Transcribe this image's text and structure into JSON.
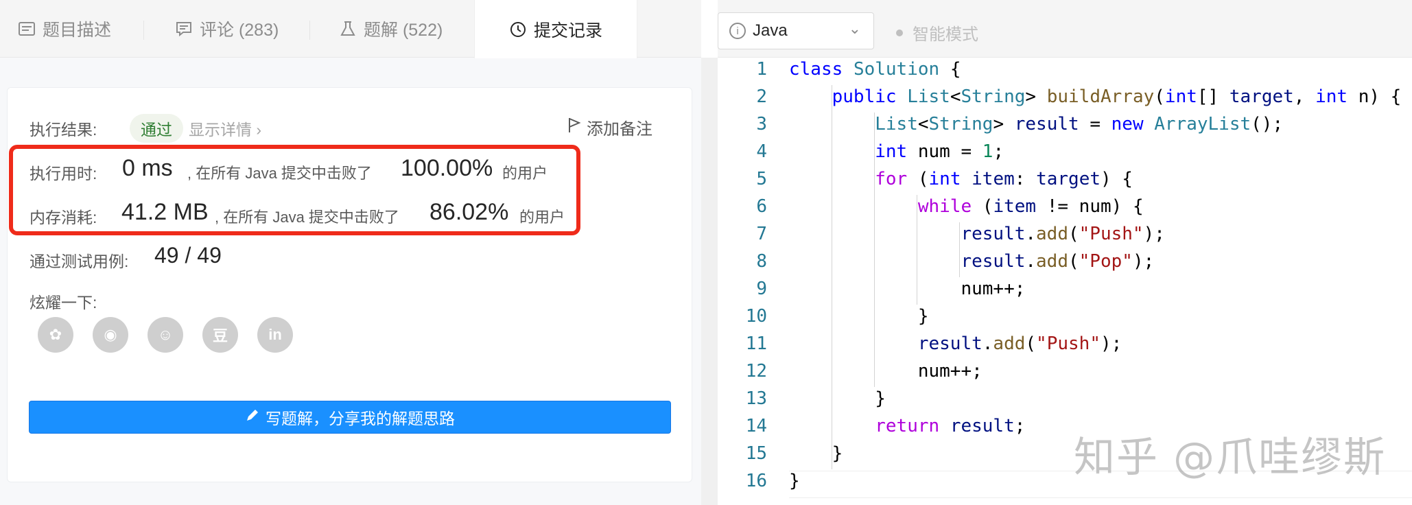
{
  "tabs": [
    {
      "label": "题目描述",
      "icon": "description-icon"
    },
    {
      "label": "评论 (283)",
      "icon": "comment-icon"
    },
    {
      "label": "题解 (522)",
      "icon": "flask-icon"
    },
    {
      "label": "提交记录",
      "icon": "clock-icon"
    }
  ],
  "result": {
    "status_label": "执行结果:",
    "status_value": "通过",
    "show_detail": "显示详情 ›",
    "add_note": "添加备注",
    "runtime_label": "执行用时:",
    "runtime_value": "0 ms",
    "runtime_mid": ", 在所有 Java 提交中击败了",
    "runtime_pct": "100.00%",
    "runtime_suffix": "的用户",
    "memory_label": "内存消耗:",
    "memory_value": "41.2 MB",
    "memory_mid": ", 在所有 Java 提交中击败了",
    "memory_pct": "86.02%",
    "memory_suffix": "的用户",
    "tests_label": "通过测试用例:",
    "tests_value": "49  /  49",
    "share_label": "炫耀一下:",
    "share_icons": [
      "wechat-icon",
      "weibo-icon",
      "qq-icon",
      "douban-icon",
      "linkedin-icon"
    ],
    "share_glyphs": [
      "✿",
      "◉",
      "☺",
      "豆",
      "in"
    ],
    "write_button": "写题解，分享我的解题思路"
  },
  "editor": {
    "language": "Java",
    "mode": "智能模式"
  },
  "code_lines": [
    "1",
    "2",
    "3",
    "4",
    "5",
    "6",
    "7",
    "8",
    "9",
    "10",
    "11",
    "12",
    "13",
    "14",
    "15",
    "16"
  ],
  "code_text": [
    "class Solution {",
    "    public List<String> buildArray(int[] target, int n) {",
    "        List<String> result = new ArrayList();",
    "        int num = 1;",
    "        for (int item: target) {",
    "            while (item != num) {",
    "                result.add(\"Push\");",
    "                result.add(\"Pop\");",
    "                num++;",
    "            }",
    "            result.add(\"Push\");",
    "            num++;",
    "        }",
    "        return result;",
    "    }",
    "}"
  ],
  "watermark": "知乎 @爪哇缪斯",
  "colors": {
    "accent": "#1a90ff",
    "highlight_box": "#ef2b1a",
    "pass_green": "#2e7d32"
  }
}
